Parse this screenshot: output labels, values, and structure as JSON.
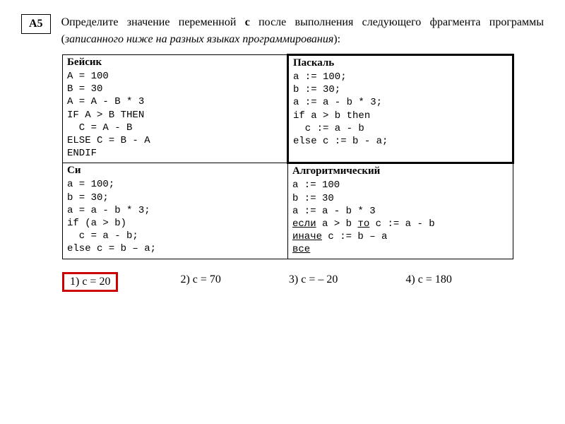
{
  "question": {
    "label": "A5",
    "text_before_bold": "Определите значение переменной ",
    "bold_var": "с",
    "text_after_bold": " после выполнения следующего фрагмента программы (",
    "italic_text": "записанного ниже на разных языках программирования",
    "text_end": "):"
  },
  "cells": {
    "basic": {
      "title": "Бейсик",
      "code": "A = 100\nB = 30\nA = A - B * 3\nIF A > B THEN\n  C = A - B\nELSE C = B - A\nENDIF"
    },
    "pascal": {
      "title": "Паскаль",
      "code": "a := 100;\nb := 30;\na := a - b * 3;\nif a > b then\n  c := a - b\nelse c := b - a;"
    },
    "c": {
      "title": "Си",
      "code": "a = 100;\nb = 30;\na = a - b * 3;\nif (a > b)\n  c = a - b;\nelse c = b – a;"
    },
    "alg": {
      "title": "Алгоритмический",
      "line1": "a := 100",
      "line2": "b := 30",
      "line3": "a := a - b * 3",
      "if_kw": "если",
      "if_cond": " a > b ",
      "then_kw": "то",
      "then_body": " c := a - b",
      "else_kw": "иначе",
      "else_body": " c := b – a",
      "end_kw": "все"
    }
  },
  "answers": {
    "a1": "1)  c = 20",
    "a2": "2)  c = 70",
    "a3": "3)  c = – 20",
    "a4": "4)  c = 180"
  }
}
